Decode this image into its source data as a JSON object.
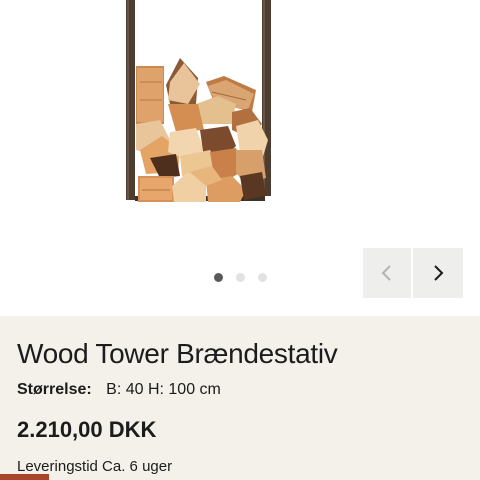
{
  "gallery": {
    "image_alt": "Wood Tower Brændestativ",
    "slide_count": 3,
    "active_slide": 1,
    "prev_icon": "chevron-left-icon",
    "next_icon": "chevron-right-icon"
  },
  "product": {
    "title": "Wood Tower Brændestativ",
    "size_label": "Størrelse:",
    "size_value": "B: 40 H: 100 cm",
    "price": "2.210,00 DKK",
    "delivery": "Leveringstid Ca. 6 uger"
  },
  "colors": {
    "info_background": "#f4f1ea",
    "accent": "#a8452a",
    "rack_metal": "#4a3a2f"
  }
}
